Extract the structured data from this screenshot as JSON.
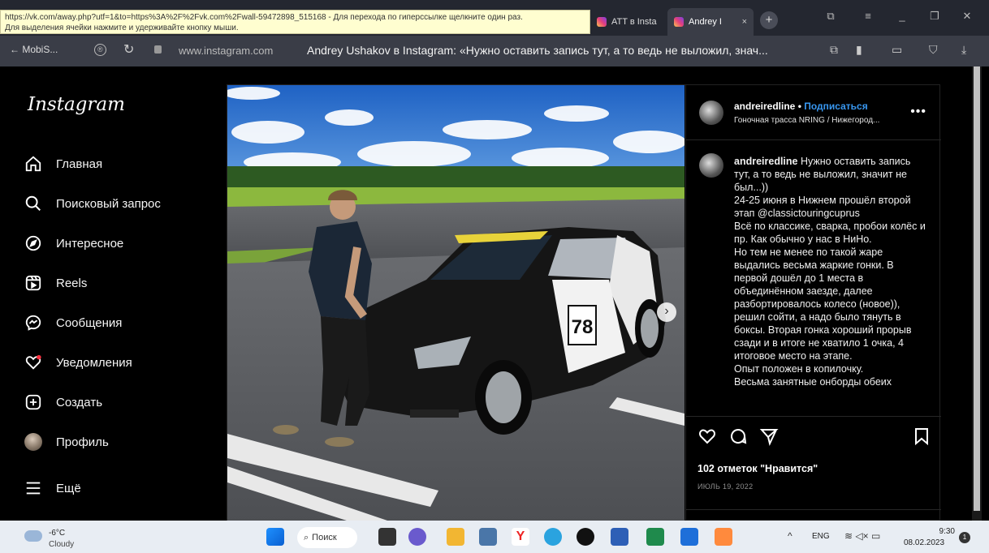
{
  "browser": {
    "tooltip_line1": "https://vk.com/away.php?utf=1&to=https%3A%2F%2Fvk.com%2Fwall-59472898_515168 - Для перехода по гиперссылке щелкните один раз.",
    "tooltip_line2": "Для выделения ячейки нажмите и удерживайте кнопку мыши.",
    "tabs": [
      {
        "label": "ATT в Insta"
      },
      {
        "label": "Andrey I",
        "close": "×"
      }
    ],
    "new_tab": "+",
    "back_label": "← MobiS...",
    "url": "www.instagram.com",
    "page_title": "Andrey Ushakov в Instagram: «Нужно оставить запись тут, а то ведь не выложил, знач..."
  },
  "sidebar": {
    "logo": "Instagram",
    "items": [
      {
        "label": "Главная",
        "icon": "home-icon"
      },
      {
        "label": "Поисковый запрос",
        "icon": "search-icon"
      },
      {
        "label": "Интересное",
        "icon": "compass-icon"
      },
      {
        "label": "Reels",
        "icon": "reels-icon"
      },
      {
        "label": "Сообщения",
        "icon": "messenger-icon"
      },
      {
        "label": "Уведомления",
        "icon": "heart-icon"
      },
      {
        "label": "Создать",
        "icon": "plus-square-icon"
      },
      {
        "label": "Профиль",
        "icon": "avatar-icon"
      },
      {
        "label": "Ещё",
        "icon": "menu-icon"
      }
    ]
  },
  "post": {
    "username": "andreiredline",
    "dot": "•",
    "follow": "Подписаться",
    "location": "Гоночная трасса NRING / Нижегород...",
    "caption_user": "andreiredline",
    "caption_text": " Нужно оставить запись тут, а то ведь не выложил, значит не был...))\n24-25 июня в Нижнем прошёл второй этап @classictouringcuprus\nВсё по классике, сварка, пробои колёс и пр. Как обычно у нас в НиНо.\nНо тем не менее по такой жаре выдались весьма жаркие гонки. В первой дошёл до 1 места в объединённом заезде, далее разбортировалось колесо (новое)), решил сойти, а надо было тянуть в боксы. Вторая гонка хороший прорыв сзади и в итоге не хватило 1 очка, 4 итоговое место на этапе.\nОпыт положен в копилочку.\nВесьма занятные онборды обеих",
    "likes": "102 отметок \"Нравится\"",
    "date": "ИЮЛЬ 19, 2022",
    "car_number": "78"
  },
  "taskbar": {
    "temp": "-6°C",
    "weather": "Cloudy",
    "search": "Поиск",
    "lang": "ENG",
    "time": "9:30",
    "date": "08.02.2023",
    "notif_count": "1"
  }
}
